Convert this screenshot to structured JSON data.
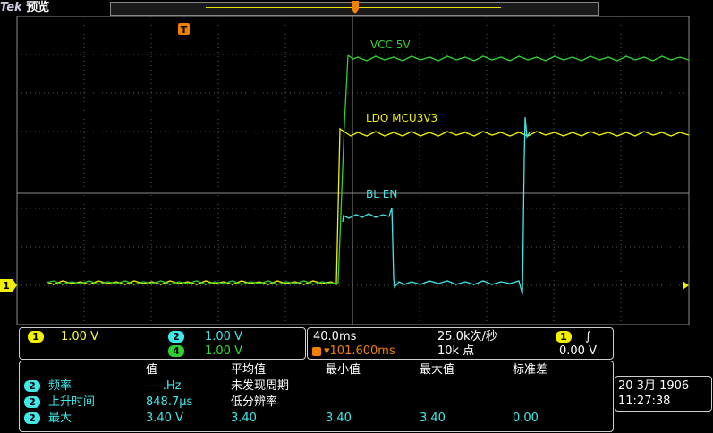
{
  "header": {
    "brand": "Tek",
    "mode": "预览",
    "trigger_marker": "T"
  },
  "waveforms": [
    {
      "label": "VCC  5V",
      "channel": "4",
      "color": "#30e030"
    },
    {
      "label": "LDO  MCU3V3",
      "channel": "1",
      "color": "#f0f000"
    },
    {
      "label": "BL  EN",
      "channel": "2",
      "color": "#40e8e8"
    }
  ],
  "level_markers": {
    "left": "1"
  },
  "channels": {
    "ch1": {
      "num": "1",
      "scale": "1.00 V"
    },
    "ch2": {
      "num": "2",
      "scale": "1.00 V"
    },
    "ch4": {
      "num": "4",
      "scale": "1.00 V"
    }
  },
  "timebase": {
    "scale": "40.0ms",
    "sample_rate": "25.0k次/秒",
    "trigger_pos": "▾101.600ms",
    "record_length": "10k 点",
    "trigger_channel": "1",
    "trigger_slope": "∫",
    "trigger_level": "0.00 V"
  },
  "measurements": {
    "headers": [
      "值",
      "平均值",
      "最小值",
      "最大值",
      "标准差"
    ],
    "rows": [
      {
        "ch": "2",
        "name": "频率",
        "value": "----.Hz",
        "mean": "未发现周期",
        "min": "",
        "max": "",
        "std": ""
      },
      {
        "ch": "2",
        "name": "上升时间",
        "value": "848.7µs",
        "mean": "低分辨率",
        "min": "",
        "max": "",
        "std": ""
      },
      {
        "ch": "2",
        "name": "最大",
        "value": "3.40 V",
        "mean": "3.40",
        "min": "3.40",
        "max": "3.40",
        "std": "0.00"
      }
    ]
  },
  "datetime": {
    "date": "20 3月  1906",
    "time": "11:27:38"
  }
}
